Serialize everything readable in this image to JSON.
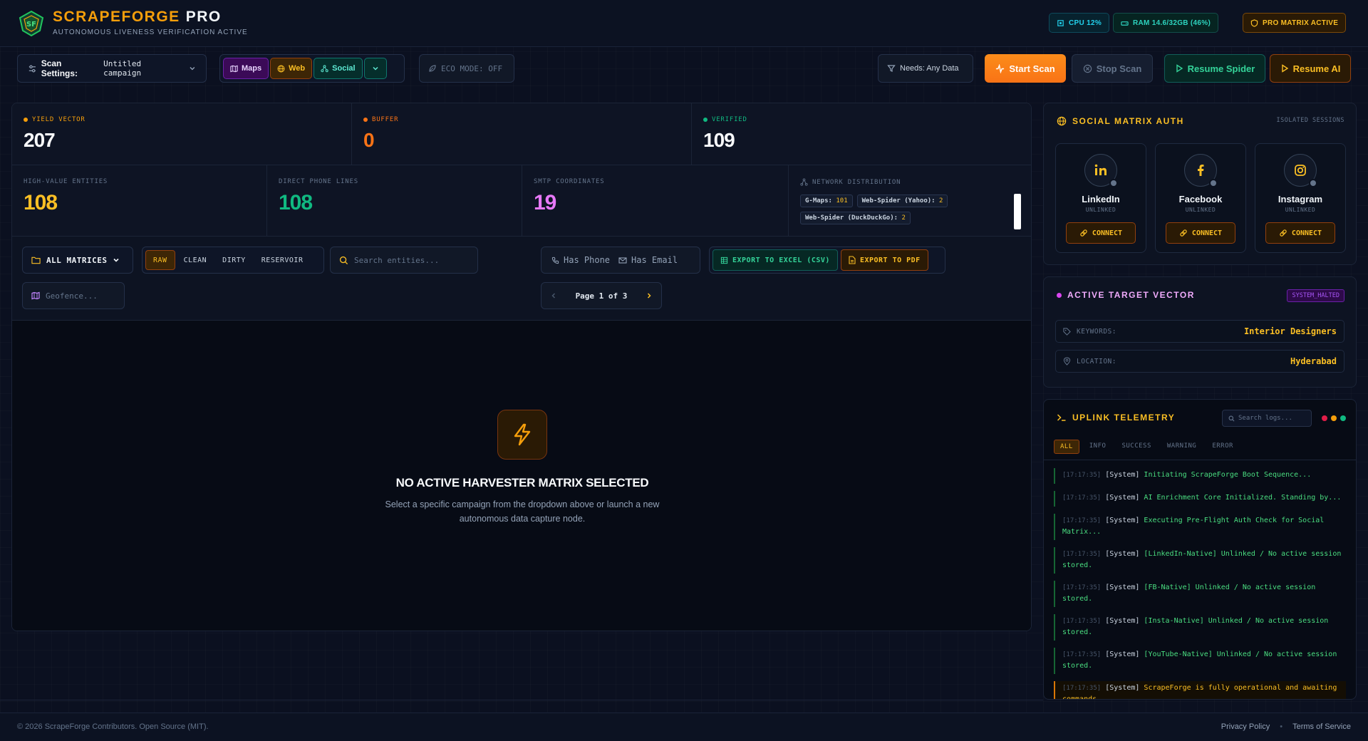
{
  "header": {
    "brand_main": "SCRAPEFORGE",
    "brand_suffix": "PRO",
    "subtitle": "AUTONOMOUS LIVENESS VERIFICATION ACTIVE",
    "cpu": "CPU 12%",
    "ram": "RAM 14.6/32GB (46%)",
    "plan": "PRO MATRIX ACTIVE"
  },
  "toolbar": {
    "scan_settings_label": "Scan Settings:",
    "scan_settings_value": "Untitled campaign",
    "sources": [
      "Maps",
      "Web",
      "Social"
    ],
    "eco_mode": "ECO MODE: OFF",
    "needs": "Needs: Any Data",
    "start": "Start Scan",
    "stop": "Stop Scan",
    "resume_spider": "Resume Spider",
    "resume_ai": "Resume AI"
  },
  "stats_top": [
    {
      "label": "YIELD VECTOR",
      "value": "207",
      "color": "#f59e0b",
      "num_color": "#f8fafc"
    },
    {
      "label": "BUFFER",
      "value": "0",
      "color": "#f97316",
      "num_color": "#f97316"
    },
    {
      "label": "VERIFIED",
      "value": "109",
      "color": "#10b981",
      "num_color": "#f8fafc"
    }
  ],
  "stats_bottom": [
    {
      "label": "HIGH-VALUE ENTITIES",
      "value": "108",
      "color": "#fbbf24"
    },
    {
      "label": "DIRECT PHONE LINES",
      "value": "108",
      "color": "#10b981"
    },
    {
      "label": "SMTP COORDINATES",
      "value": "19",
      "color": "#e879f9"
    }
  ],
  "network": {
    "label": "NETWORK DISTRIBUTION",
    "tags": [
      {
        "name": "G-Maps:",
        "count": "101"
      },
      {
        "name": "Web-Spider (Yahoo):",
        "count": "2"
      },
      {
        "name": "Web-Spider (DuckDuckGo):",
        "count": "2"
      }
    ]
  },
  "filters": {
    "all_matrices": "ALL MATRICES",
    "segments": [
      "RAW",
      "CLEAN",
      "DIRTY",
      "RESERVOIR"
    ],
    "search_placeholder": "Search entities...",
    "has_phone": "Has Phone",
    "has_email": "Has Email",
    "export_excel": "EXPORT TO EXCEL (CSV)",
    "export_pdf": "EXPORT TO PDF",
    "geofence_placeholder": "Geofence...",
    "page": "Page 1 of 3"
  },
  "empty_state": {
    "title": "NO ACTIVE HARVESTER MATRIX SELECTED",
    "description": "Select a specific campaign from the dropdown above or launch a new autonomous data capture node."
  },
  "social_auth": {
    "title": "SOCIAL MATRIX AUTH",
    "badge": "ISOLATED SESSIONS",
    "accounts": [
      {
        "name": "LinkedIn",
        "status": "UNLINKED",
        "button": "CONNECT"
      },
      {
        "name": "Facebook",
        "status": "UNLINKED",
        "button": "CONNECT"
      },
      {
        "name": "Instagram",
        "status": "UNLINKED",
        "button": "CONNECT"
      }
    ]
  },
  "target": {
    "title": "ACTIVE TARGET VECTOR",
    "badge": "SYSTEM_HALTED",
    "keywords_label": "KEYWORDS:",
    "keywords_value": "Interior Designers",
    "location_label": "LOCATION:",
    "location_value": "Hyderabad"
  },
  "telemetry": {
    "title": "UPLINK TELEMETRY",
    "search_placeholder": "Search logs...",
    "tabs": [
      "ALL",
      "INFO",
      "SUCCESS",
      "WARNING",
      "ERROR"
    ],
    "logs": [
      {
        "ts": "[17:17:35]",
        "src": "[System]",
        "msg": "Initiating ScrapeForge Boot Sequence...",
        "level": "success"
      },
      {
        "ts": "[17:17:35]",
        "src": "[System]",
        "msg": "AI Enrichment Core Initialized. Standing by...",
        "level": "success"
      },
      {
        "ts": "[17:17:35]",
        "src": "[System]",
        "msg": "Executing Pre-Flight Auth Check for Social Matrix...",
        "level": "success"
      },
      {
        "ts": "[17:17:35]",
        "src": "[System]",
        "msg": "[LinkedIn-Native] Unlinked / No active session stored.",
        "level": "success"
      },
      {
        "ts": "[17:17:35]",
        "src": "[System]",
        "msg": "[FB-Native] Unlinked / No active session stored.",
        "level": "success"
      },
      {
        "ts": "[17:17:35]",
        "src": "[System]",
        "msg": "[Insta-Native] Unlinked / No active session stored.",
        "level": "success"
      },
      {
        "ts": "[17:17:35]",
        "src": "[System]",
        "msg": "[YouTube-Native] Unlinked / No active session stored.",
        "level": "success"
      },
      {
        "ts": "[17:17:35]",
        "src": "[System]",
        "msg": "ScrapeForge is fully operational and awaiting commands.",
        "level": "warning"
      }
    ]
  },
  "footer": {
    "copyright": "© 2026 ScrapeForge Contributors. Open Source (MIT).",
    "privacy": "Privacy Policy",
    "terms": "Terms of Service"
  }
}
